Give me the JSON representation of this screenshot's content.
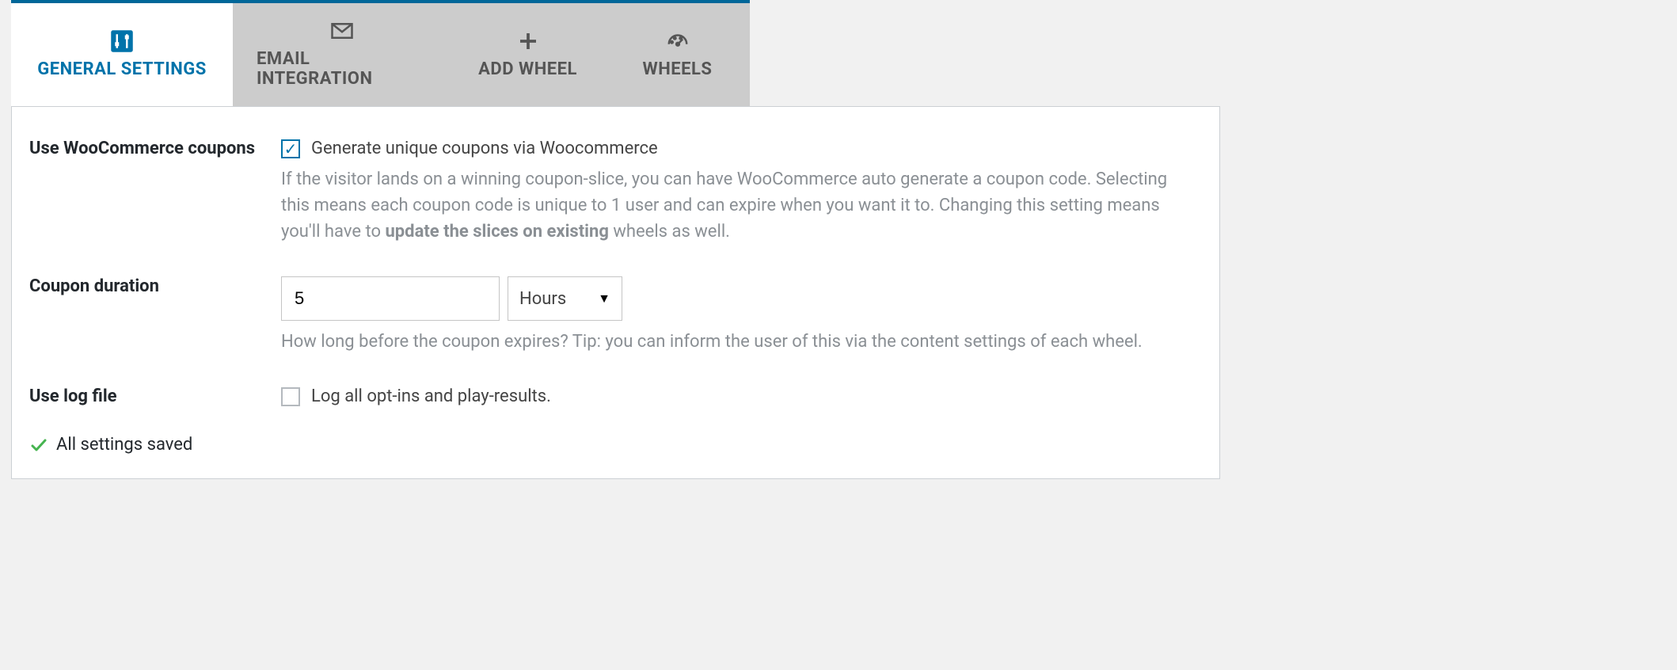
{
  "tabs": {
    "general": "GENERAL SETTINGS",
    "email": "EMAIL INTEGRATION",
    "add": "ADD WHEEL",
    "wheels": "WHEELS"
  },
  "rows": {
    "woo": {
      "label": "Use WooCommerce coupons",
      "checkbox_label": "Generate unique coupons via Woocommerce",
      "desc1": "If the visitor lands on a winning coupon-slice, you can have WooCommerce auto generate a coupon code. Selecting this means each coupon code is unique to 1 user and can expire when you want it to. Changing this setting means you'll have to ",
      "desc_bold": "update the slices on existing",
      "desc2": " wheels as well."
    },
    "duration": {
      "label": "Coupon duration",
      "value": "5",
      "unit": "Hours",
      "desc": "How long before the coupon expires? Tip: you can inform the user of this via the content settings of each wheel."
    },
    "log": {
      "label": "Use log file",
      "checkbox_label": "Log all opt-ins and play-results."
    }
  },
  "status": "All settings saved"
}
